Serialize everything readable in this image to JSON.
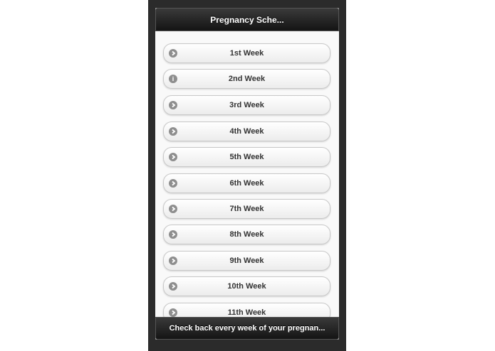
{
  "header": {
    "title": "Pregnancy Sche..."
  },
  "weeks": [
    {
      "label": "1st Week",
      "icon": "arrow-right-icon"
    },
    {
      "label": "2nd Week",
      "icon": "info-icon"
    },
    {
      "label": "3rd Week",
      "icon": "arrow-right-icon"
    },
    {
      "label": "4th Week",
      "icon": "arrow-right-icon"
    },
    {
      "label": "5th Week",
      "icon": "arrow-right-icon"
    },
    {
      "label": "6th Week",
      "icon": "arrow-right-icon"
    },
    {
      "label": "7th Week",
      "icon": "arrow-right-icon"
    },
    {
      "label": "8th Week",
      "icon": "arrow-right-icon"
    },
    {
      "label": "9th Week",
      "icon": "arrow-right-icon"
    },
    {
      "label": "10th Week",
      "icon": "arrow-right-icon"
    },
    {
      "label": "11th Week",
      "icon": "arrow-right-icon"
    }
  ],
  "footer": {
    "text": "Check back every week of your pregnan..."
  },
  "colors": {
    "bar": "#1e1e1e",
    "frame": "#2b2b2b",
    "icon": "#8e8e8e",
    "text": "#333333"
  }
}
